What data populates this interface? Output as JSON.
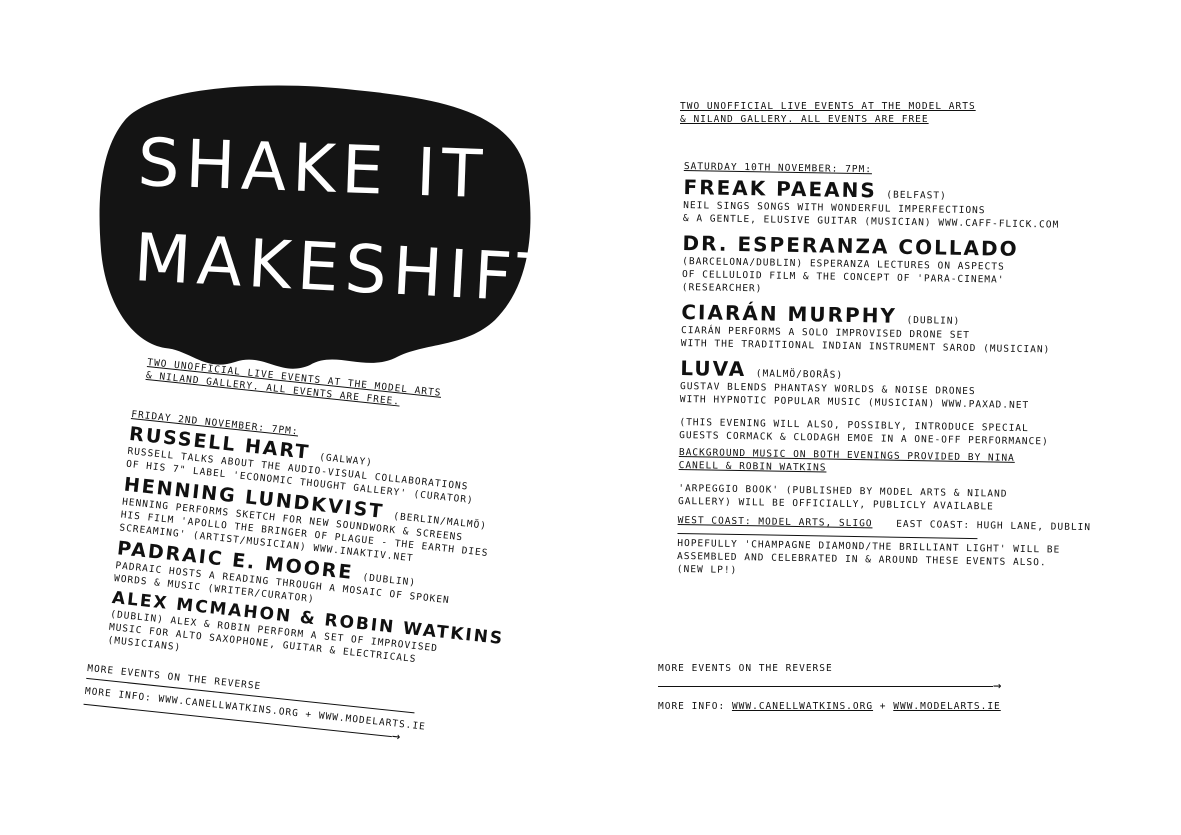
{
  "left": {
    "title_line1": "SHAKE IT",
    "title_line2": "MAKESHIFT",
    "intro_line1": "TWO UNOFFICIAL LIVE EVENTS AT THE MODEL ARTS",
    "intro_line2": "& NILAND GALLERY. ALL EVENTS ARE FREE.",
    "date": "FRIDAY 2ND NOVEMBER: 7PM:",
    "acts": [
      {
        "name": "RUSSELL HART",
        "origin": "(GALWAY)",
        "desc": [
          "RUSSELL TALKS ABOUT THE AUDIO-VISUAL COLLABORATIONS",
          "OF HIS 7\" LABEL 'ECONOMIC THOUGHT GALLERY' (CURATOR)"
        ]
      },
      {
        "name": "HENNING LUNDKVIST",
        "origin": "(BERLIN/MALMÖ)",
        "desc": [
          "HENNING PERFORMS SKETCH FOR NEW SOUNDWORK & SCREENS",
          "HIS FILM 'APOLLO THE BRINGER OF PLAGUE - THE EARTH DIES",
          "SCREAMING' (ARTIST/MUSICIAN) WWW.INAKTIV.NET"
        ]
      },
      {
        "name": "PADRAIC E. MOORE",
        "origin": "(DUBLIN)",
        "desc": [
          "PADRAIC HOSTS A READING THROUGH A MOSAIC OF SPOKEN",
          "WORDS & MUSIC (WRITER/CURATOR)"
        ]
      },
      {
        "name": "ALEX MCMAHON & ROBIN WATKINS",
        "origin": "",
        "desc": [
          "(DUBLIN) ALEX & ROBIN PERFORM A SET OF IMPROVISED",
          "MUSIC FOR ALTO SAXOPHONE, GUITAR & ELECTRICALS",
          "(MUSICIANS)"
        ]
      }
    ],
    "more_events": "MORE EVENTS ON THE REVERSE",
    "more_info": "MORE INFO: WWW.CANELLWATKINS.ORG + WWW.MODELARTS.IE",
    "arrow": "→"
  },
  "right": {
    "intro_line1": "TWO UNOFFICIAL LIVE EVENTS AT THE MODEL ARTS",
    "intro_line2": "& NILAND GALLERY. ALL EVENTS ARE FREE",
    "date": "SATURDAY 10TH NOVEMBER: 7PM:",
    "acts": [
      {
        "name": "FREAK PAEANS",
        "origin": "(BELFAST)",
        "desc": [
          "NEIL SINGS SONGS WITH WONDERFUL IMPERFECTIONS",
          "& A GENTLE, ELUSIVE GUITAR (MUSICIAN) WWW.CAFF-FLICK.COM"
        ]
      },
      {
        "name": "DR. ESPERANZA COLLADO",
        "origin": "",
        "desc": [
          "(BARCELONA/DUBLIN) ESPERANZA LECTURES ON ASPECTS",
          "OF CELLULOID FILM & THE CONCEPT OF 'PARA-CINEMA'",
          "(RESEARCHER)"
        ]
      },
      {
        "name": "CIARÁN MURPHY",
        "origin": "(DUBLIN)",
        "desc": [
          "CIARÁN PERFORMS A SOLO IMPROVISED DRONE SET",
          "WITH THE TRADITIONAL INDIAN INSTRUMENT SAROD (MUSICIAN)"
        ]
      },
      {
        "name": "LUVA",
        "origin": "(MALMÖ/BORÅS)",
        "desc": [
          "GUSTAV BLENDS PHANTASY WORLDS & NOISE DRONES",
          "WITH HYPNOTIC POPULAR MUSIC (MUSICIAN) WWW.PAXAD.NET"
        ]
      }
    ],
    "note": [
      "(THIS EVENING WILL ALSO, POSSIBLY, INTRODUCE SPECIAL",
      "GUESTS CORMACK & CLODAGH EMOE IN A ONE-OFF PERFORMANCE)"
    ],
    "background": [
      "BACKGROUND MUSIC ON BOTH EVENINGS PROVIDED BY NINA",
      "CANELL & ROBIN WATKINS"
    ],
    "arpeggio": [
      "'ARPEGGIO BOOK' (PUBLISHED BY MODEL ARTS & NILAND",
      "GALLERY) WILL BE OFFICIALLY, PUBLICLY AVAILABLE"
    ],
    "west_coast": "WEST COAST: MODEL ARTS, SLIGO",
    "east_coast": "EAST COAST: HUGH LANE, DUBLIN",
    "hopefully": [
      "HOPEFULLY 'CHAMPAGNE DIAMOND/THE BRILLIANT LIGHT' WILL BE",
      "ASSEMBLED AND CELEBRATED IN & AROUND THESE EVENTS ALSO.",
      "(NEW LP!)"
    ],
    "more_events": "MORE EVENTS ON THE REVERSE",
    "more_info_label": "MORE INFO:",
    "more_info_url1": "WWW.CANELLWATKINS.ORG",
    "plus": "+",
    "more_info_url2": "WWW.MODELARTS.IE",
    "arrow": "→"
  }
}
